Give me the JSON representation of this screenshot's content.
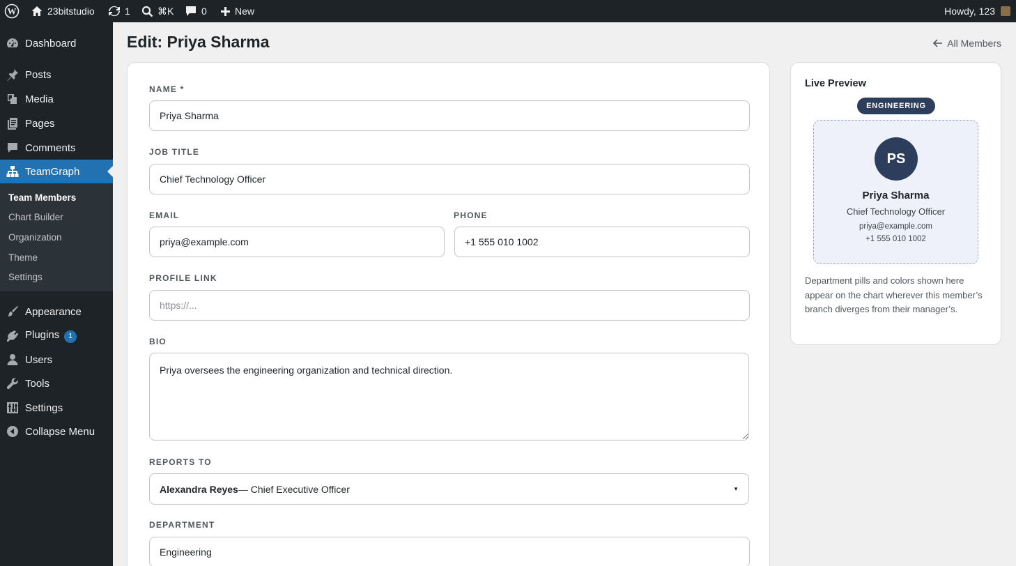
{
  "admin_bar": {
    "site_name": "23bitstudio",
    "updates_count": "1",
    "search_shortcut": "⌘K",
    "comments_count": "0",
    "new_label": "New",
    "howdy": "Howdy, 123"
  },
  "sidebar": {
    "items": [
      {
        "label": "Dashboard",
        "icon": "dashboard-icon"
      },
      {
        "label": "Posts",
        "icon": "pin-icon"
      },
      {
        "label": "Media",
        "icon": "media-icon"
      },
      {
        "label": "Pages",
        "icon": "pages-icon"
      },
      {
        "label": "Comments",
        "icon": "comment-icon"
      },
      {
        "label": "TeamGraph",
        "icon": "org-chart-icon"
      }
    ],
    "submenu": [
      "Team Members",
      "Chart Builder",
      "Organization",
      "Theme",
      "Settings"
    ],
    "items2": [
      {
        "label": "Appearance",
        "icon": "brush-icon"
      },
      {
        "label": "Plugins",
        "icon": "plugin-icon",
        "badge": "1"
      },
      {
        "label": "Users",
        "icon": "user-icon"
      },
      {
        "label": "Tools",
        "icon": "wrench-icon"
      },
      {
        "label": "Settings",
        "icon": "settings-icon"
      },
      {
        "label": "Collapse Menu",
        "icon": "collapse-icon"
      }
    ]
  },
  "page": {
    "title": "Edit: Priya Sharma",
    "back_link": "All Members"
  },
  "form": {
    "name_label": "NAME *",
    "name_value": "Priya Sharma",
    "job_title_label": "JOB TITLE",
    "job_title_value": "Chief Technology Officer",
    "email_label": "EMAIL",
    "email_value": "priya@example.com",
    "phone_label": "PHONE",
    "phone_value": "+1 555 010 1002",
    "profile_link_label": "PROFILE LINK",
    "profile_link_placeholder": "https://...",
    "bio_label": "BIO",
    "bio_value": "Priya oversees the engineering organization and technical direction.",
    "reports_to_label": "REPORTS TO",
    "reports_to_name": "Alexandra Reyes",
    "reports_to_title": " — Chief Executive Officer",
    "department_label": "DEPARTMENT",
    "department_value": "Engineering"
  },
  "preview": {
    "title": "Live Preview",
    "department_pill": "ENGINEERING",
    "initials": "PS",
    "name": "Priya Sharma",
    "job_title": "Chief Technology Officer",
    "email": "priya@example.com",
    "phone": "+1 555 010 1002",
    "note": "Department pills and colors shown here appear on the chart wherever this member’s branch diverges from their manager’s.",
    "accent_color": "#2c3e5c"
  },
  "colors": {
    "admin_bg": "#1d2327",
    "menu_current": "#2271b1"
  }
}
